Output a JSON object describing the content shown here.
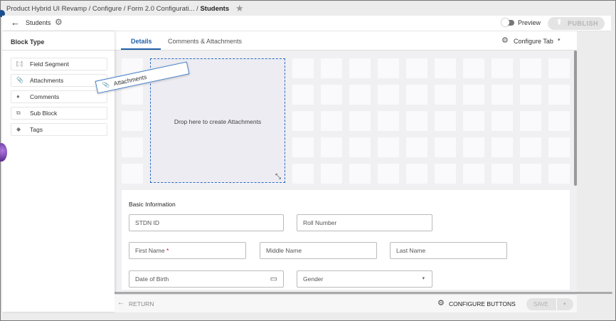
{
  "breadcrumb": {
    "items": [
      "Product Hybrid UI Revamp",
      "Configure",
      "Form 2.0 Configurati..."
    ],
    "current": "Students"
  },
  "header": {
    "title": "Students",
    "preview_label": "Preview",
    "publish_label": "PUBLISH"
  },
  "sidebar": {
    "title": "Block Type",
    "items": [
      {
        "label": "Field Segment",
        "icon": "[::]"
      },
      {
        "label": "Attachments",
        "icon": "📎"
      },
      {
        "label": "Comments",
        "icon": "●"
      },
      {
        "label": "Sub Block",
        "icon": "⧉"
      },
      {
        "label": "Tags",
        "icon": "◆"
      }
    ]
  },
  "tabs": [
    {
      "label": "Details",
      "active": true
    },
    {
      "label": "Comments & Attachments"
    }
  ],
  "configure_tab_label": "Configure Tab",
  "drag": {
    "ghost_label": "Attachments",
    "drop_text": "Drop here to create Attachments"
  },
  "form": {
    "section_title": "Basic Information",
    "fields": {
      "stdn_id": "STDN ID",
      "roll_number": "Roll Number",
      "first_name": "First Name",
      "required_mark": "*",
      "middle_name": "Middle Name",
      "last_name": "Last Name",
      "dob": "Date of Birth",
      "gender": "Gender"
    }
  },
  "footer": {
    "return_label": "RETURN",
    "configure_buttons_label": "CONFIGURE BUTTONS",
    "save_label": "SAVE"
  },
  "colors": {
    "accent": "#1f5fa8",
    "required": "#d0021b"
  }
}
